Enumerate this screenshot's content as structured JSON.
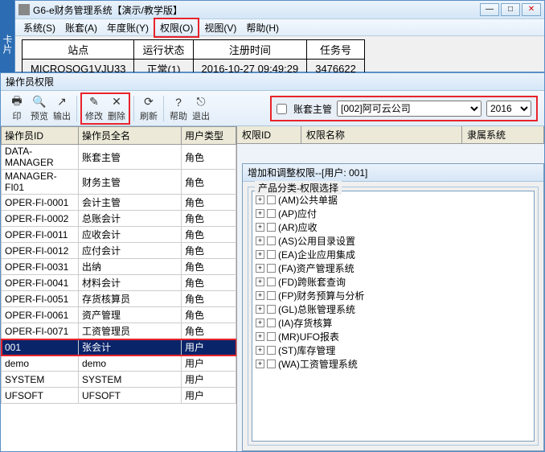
{
  "main": {
    "title": "G6-e财务管理系统【演示/教学版】",
    "menus": [
      "系统(S)",
      "账套(A)",
      "年度账(Y)",
      "权限(O)",
      "视图(V)",
      "帮助(H)"
    ],
    "infoHeaders": [
      "站点",
      "运行状态",
      "注册时间",
      "任务号"
    ],
    "infoValues": [
      "MICROSOG1VJU33",
      "正常(1)",
      "2016-10-27 09:49:29",
      "3476622"
    ],
    "leftStrip": "卡片"
  },
  "perm": {
    "title": "操作员权限",
    "tools": {
      "print": "印",
      "preview": "预览",
      "output": "输出",
      "modify": "修改",
      "delete": "删除",
      "refresh": "刷新",
      "help": "帮助",
      "exit": "退出"
    },
    "filter": {
      "checkboxLabel": "账套主管",
      "entity": "[002]阿可云公司",
      "year": "2016"
    },
    "gridHeaders": [
      "操作员ID",
      "操作员全名",
      "用户类型"
    ],
    "rows": [
      {
        "id": "DATA-MANAGER",
        "name": "账套主管",
        "type": "角色"
      },
      {
        "id": "MANAGER-FI01",
        "name": "财务主管",
        "type": "角色"
      },
      {
        "id": "OPER-FI-0001",
        "name": "会计主管",
        "type": "角色"
      },
      {
        "id": "OPER-FI-0002",
        "name": "总账会计",
        "type": "角色"
      },
      {
        "id": "OPER-FI-0011",
        "name": "应收会计",
        "type": "角色"
      },
      {
        "id": "OPER-FI-0012",
        "name": "应付会计",
        "type": "角色"
      },
      {
        "id": "OPER-FI-0031",
        "name": "出纳",
        "type": "角色"
      },
      {
        "id": "OPER-FI-0041",
        "name": "材料会计",
        "type": "角色"
      },
      {
        "id": "OPER-FI-0051",
        "name": "存货核算员",
        "type": "角色"
      },
      {
        "id": "OPER-FI-0061",
        "name": "资产管理",
        "type": "角色"
      },
      {
        "id": "OPER-FI-0071",
        "name": "工资管理员",
        "type": "角色"
      },
      {
        "id": "001",
        "name": "张会计",
        "type": "用户",
        "selected": true
      },
      {
        "id": "demo",
        "name": "demo",
        "type": "用户"
      },
      {
        "id": "SYSTEM",
        "name": "SYSTEM",
        "type": "用户"
      },
      {
        "id": "UFSOFT",
        "name": "UFSOFT",
        "type": "用户"
      }
    ],
    "rightHeaders": {
      "id": "权限ID",
      "name": "权限名称",
      "sys": "隶属系统"
    },
    "subDialog": {
      "title": "增加和调整权限--[用户: 001]",
      "groupTitle": "产品分类-权限选择",
      "tree": [
        "(AM)公共单据",
        "(AP)应付",
        "(AR)应收",
        "(AS)公用目录设置",
        "(EA)企业应用集成",
        "(FA)资产管理系统",
        "(FD)跨账套查询",
        "(FP)财务预算与分析",
        "(GL)总账管理系统",
        "(IA)存货核算",
        "(MR)UFO报表",
        "(ST)库存管理",
        "(WA)工资管理系统"
      ]
    }
  }
}
